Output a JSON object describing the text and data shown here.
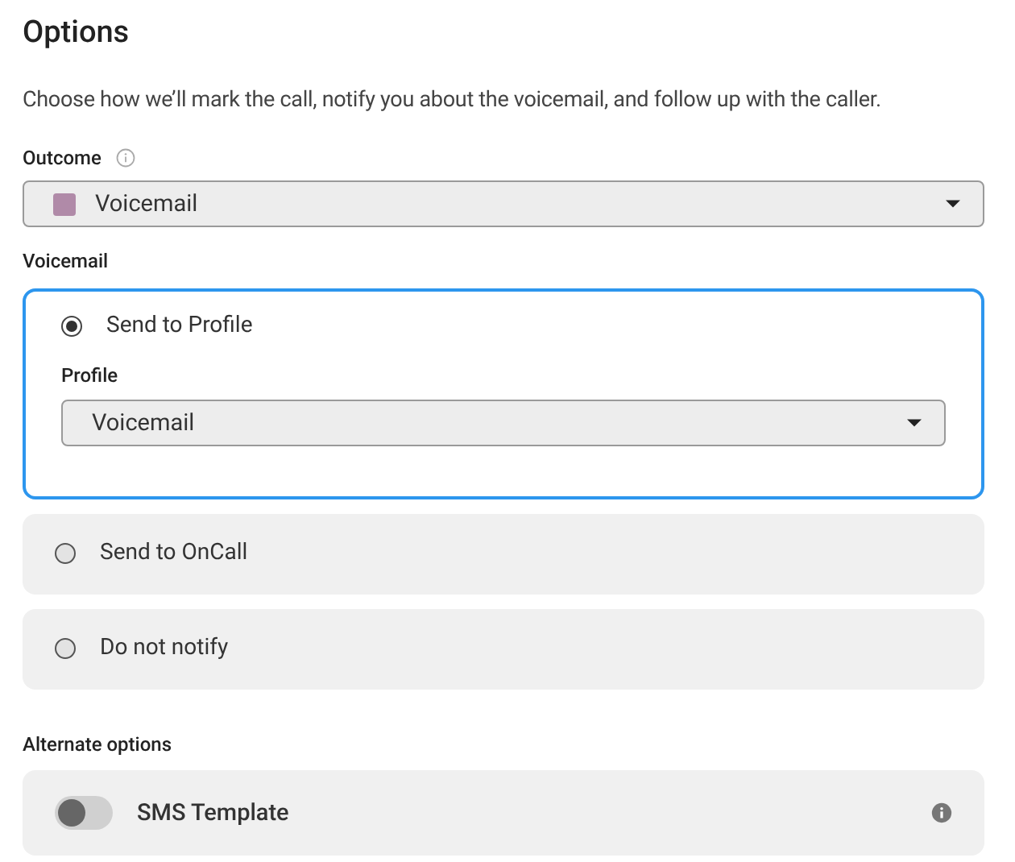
{
  "title": "Options",
  "description": "Choose how we’ll mark the call, notify you about the voicemail, and follow up with the caller.",
  "outcome": {
    "label": "Outcome",
    "value": "Voicemail",
    "color": "#b08aa8"
  },
  "voicemail": {
    "label": "Voicemail",
    "options": [
      {
        "label": "Send to Profile",
        "selected": true,
        "profile": {
          "label": "Profile",
          "value": "Voicemail"
        }
      },
      {
        "label": "Send to OnCall",
        "selected": false
      },
      {
        "label": "Do not notify",
        "selected": false
      }
    ]
  },
  "alternate": {
    "label": "Alternate options",
    "items": [
      {
        "label": "SMS Template",
        "on": false
      }
    ]
  }
}
